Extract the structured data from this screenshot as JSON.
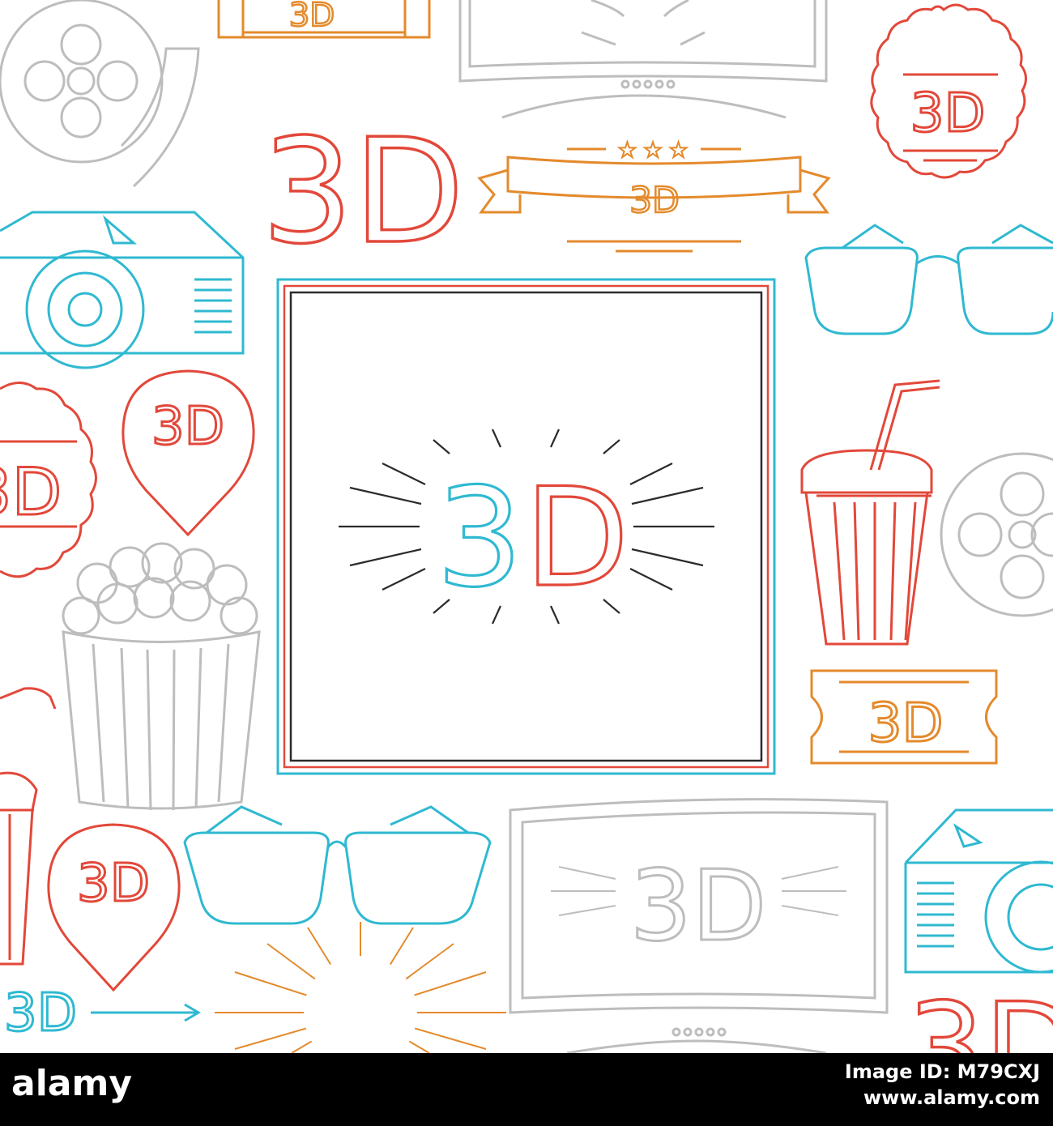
{
  "artwork": {
    "center_label": "3D",
    "badge_label": "3D",
    "colors": {
      "red": "#e2483a",
      "blue": "#2fb9d1",
      "orange": "#e48a2c",
      "gray": "#bdbdbd",
      "dark": "#2b2b2b",
      "background": "#ffffff"
    },
    "icons": [
      "film-reel-icon",
      "ticket-icon",
      "tv-screen-icon",
      "seal-badge-icon",
      "ribbon-banner-icon",
      "projector-icon",
      "glasses-icon",
      "map-pin-icon",
      "drink-cup-icon",
      "popcorn-icon",
      "sunburst-icon",
      "arrow-right-icon"
    ]
  },
  "banner": {
    "logo": "alamy",
    "image_id": "Image ID: M79CXJ",
    "url": "www.alamy.com"
  }
}
